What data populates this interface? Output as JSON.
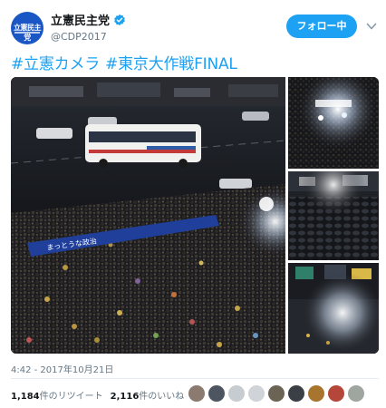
{
  "account": {
    "display_name": "立憲民主党",
    "handle": "@CDP2017",
    "avatar_text": "立憲民主党"
  },
  "follow_button": {
    "label": "フォロー中"
  },
  "tweet": {
    "hashtags": [
      "#立憲カメラ",
      "#東京大作戦FINAL"
    ]
  },
  "photos": [
    {
      "name": "crowd-main-photo",
      "banner_text": "まっとうな政治"
    },
    {
      "name": "crowd-stage-photo"
    },
    {
      "name": "crowd-umbrellas-photo"
    },
    {
      "name": "crowd-street-photo"
    }
  ],
  "meta": {
    "timestamp": "4:42 - 2017年10月21日"
  },
  "stats": {
    "retweets_count": "1,184",
    "retweets_label": "件のリツイート",
    "likes_count": "2,116",
    "likes_label": "件のいいね"
  },
  "likers": [
    {
      "icon": "liker-avatar-1",
      "color": "#8a7a70"
    },
    {
      "icon": "liker-avatar-2",
      "color": "#4d5560"
    },
    {
      "icon": "liker-avatar-3",
      "color": "#c7ccd1"
    },
    {
      "icon": "liker-avatar-4",
      "color": "#d0d4d8"
    },
    {
      "icon": "liker-avatar-5",
      "color": "#6b6455"
    },
    {
      "icon": "liker-avatar-6",
      "color": "#3a3f45"
    },
    {
      "icon": "liker-avatar-7",
      "color": "#a8752e"
    },
    {
      "icon": "liker-avatar-8",
      "color": "#b5473a"
    },
    {
      "icon": "liker-avatar-9",
      "color": "#9fa6a0"
    }
  ],
  "colors": {
    "accent": "#1da1f2",
    "text": "#14171a",
    "muted": "#657786"
  }
}
